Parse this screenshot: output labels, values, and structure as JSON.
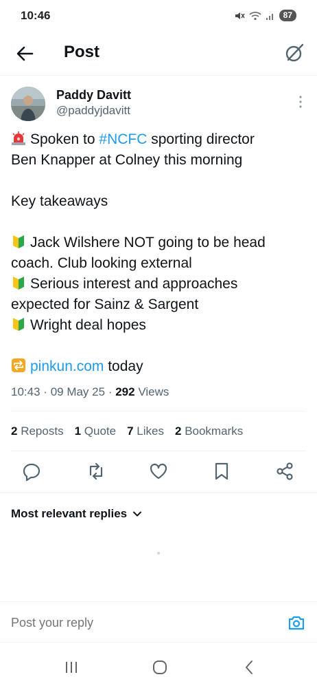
{
  "status_bar": {
    "time": "10:46",
    "battery": "87"
  },
  "header": {
    "title": "Post"
  },
  "author": {
    "name": "Paddy Davitt",
    "handle": "@paddyjdavitt"
  },
  "tweet": {
    "line1_pre": "Spoken to ",
    "line1_hashtag": "#NCFC",
    "line1_post": " sporting director",
    "line2": "Ben Knapper at Colney this morning",
    "line3": "Key takeaways",
    "line4": "Jack Wilshere NOT going to be head",
    "line5": "coach. Club looking external",
    "line6": "Serious interest and approaches",
    "line7": "expected for Sainz & Sargent",
    "line8": "Wright deal hopes",
    "link_text": "pinkun.com",
    "link_suffix": " today"
  },
  "meta": {
    "time": "10:43",
    "date": "09 May 25",
    "views_count": "292",
    "views_label": "Views"
  },
  "stats": {
    "reposts_count": "2",
    "reposts_label": "Reposts",
    "quotes_count": "1",
    "quotes_label": "Quote",
    "likes_count": "7",
    "likes_label": "Likes",
    "bookmarks_count": "2",
    "bookmarks_label": "Bookmarks"
  },
  "replies": {
    "sort_label": "Most relevant replies"
  },
  "reply_bar": {
    "placeholder": "Post your reply"
  },
  "colors": {
    "accent": "#1d9bf0",
    "text": "#0f1419",
    "secondary": "#536471"
  },
  "icons": {
    "siren": "police-light-icon",
    "beginner": "beginner-badge-icon",
    "repeat": "repeat-button-icon"
  }
}
